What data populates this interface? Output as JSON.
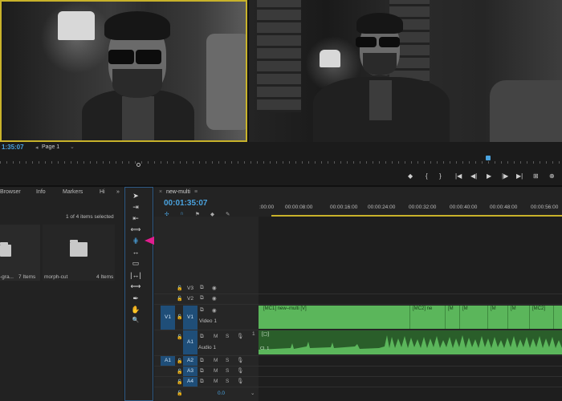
{
  "monitor": {
    "timecode": "1:35:07",
    "page_select": "Page 1",
    "page_chevron": "⌄",
    "transport": [
      "◆",
      "{",
      "}",
      "|◀",
      "◀|",
      "▶",
      "|▶",
      "▶|",
      "⊞",
      "⊕"
    ]
  },
  "project": {
    "tabs": [
      "Browser",
      "Info",
      "Markers",
      "Hi"
    ],
    "overflow": "»",
    "count": "1 of 4 items selected",
    "bins": [
      {
        "name": "-gra...",
        "items": "7 Items"
      },
      {
        "name": "morph-cut",
        "items": "4 Items"
      }
    ]
  },
  "tools": [
    "➤",
    "⇥",
    "⇤",
    "⟺",
    "⋕",
    "↔",
    "▭",
    "|↔|",
    "⟷",
    "✒",
    "✋",
    "🔍"
  ],
  "sequence": {
    "tab_close": "×",
    "name": "new-multi",
    "menu": "≡",
    "timecode": "00:01:35:07",
    "ruler": [
      ":00:00",
      "00:00:08:00",
      "00:00:16:00",
      "00:00:24:00",
      "00:00:32:00",
      "00:00:40:00",
      "00:00:48:00",
      "00:00:56:00"
    ]
  },
  "tracks": {
    "video": [
      {
        "id": "V3",
        "name": ""
      },
      {
        "id": "V2",
        "name": ""
      },
      {
        "id": "V1",
        "name": "Video 1",
        "src": "V1"
      }
    ],
    "audio": [
      {
        "id": "A1",
        "name": "Audio 1",
        "src": "A1"
      },
      {
        "id": "A2",
        "name": ""
      },
      {
        "id": "A3",
        "name": ""
      },
      {
        "id": "A4",
        "name": ""
      }
    ],
    "master_level": "0.0",
    "labels": {
      "m": "M",
      "s": "S",
      "one": "1"
    }
  },
  "clips": {
    "video_labels": [
      "[MC1] new–multi [V]",
      "[MC2] ne",
      "[M",
      "[M",
      "[M",
      "[M",
      "[MC2]"
    ],
    "audio_label": "Cl. 1"
  },
  "colors": {
    "accent": "#4aa3df",
    "clip_green": "#5bb65b",
    "target_blue": "#1f4e78",
    "annotation": "#e11d8f",
    "angle_border": "#c8b22a"
  }
}
